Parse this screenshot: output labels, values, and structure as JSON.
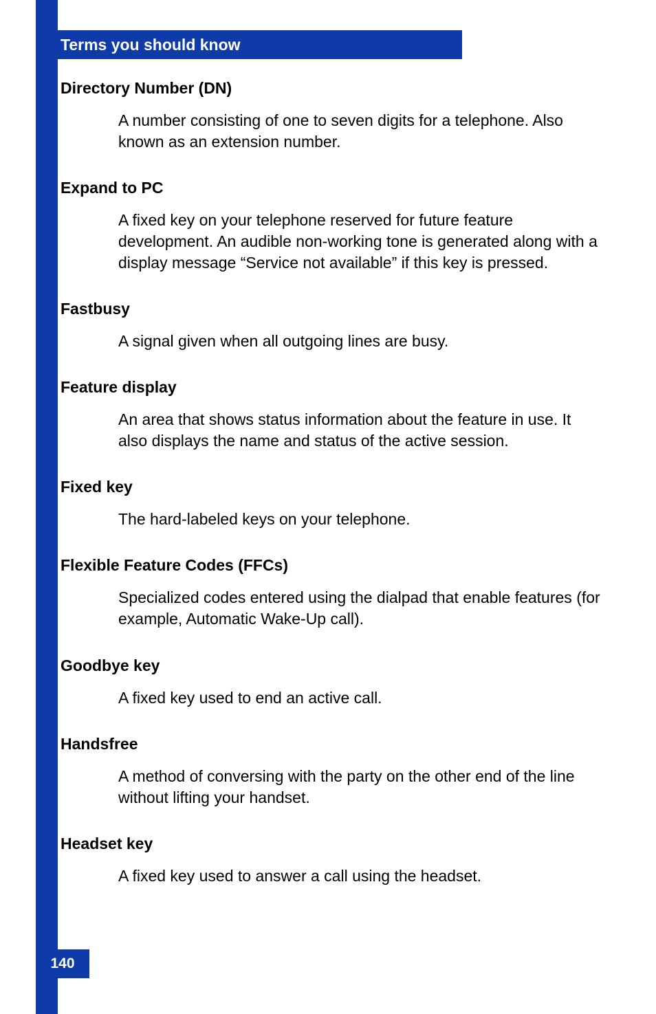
{
  "header": {
    "title": "Terms you should know"
  },
  "terms": [
    {
      "term": "Directory Number (DN)",
      "definition": "A number consisting of one to seven digits for a telephone. Also known as an extension number."
    },
    {
      "term": "Expand to PC",
      "definition": "A fixed key on your telephone reserved for future feature development. An audible non-working tone is generated along with a display message “Service not available” if this key is pressed."
    },
    {
      "term": "Fastbusy",
      "definition": "A signal given when all outgoing lines are busy."
    },
    {
      "term": "Feature display",
      "definition": "An area that shows status information about the feature in use. It also displays the name and status of the active session."
    },
    {
      "term": "Fixed key",
      "definition": "The hard-labeled keys on your telephone."
    },
    {
      "term": "Flexible Feature Codes (FFCs)",
      "definition": "Specialized codes entered using the dialpad that enable features (for example, Automatic Wake-Up call)."
    },
    {
      "term": "Goodbye key",
      "definition": "A fixed key used to end an active call."
    },
    {
      "term": "Handsfree",
      "definition": "A method of conversing with the party on the other end of the line without lifting your handset."
    },
    {
      "term": "Headset key",
      "definition": "A fixed key used to answer a call using the headset."
    }
  ],
  "page_number": "140"
}
